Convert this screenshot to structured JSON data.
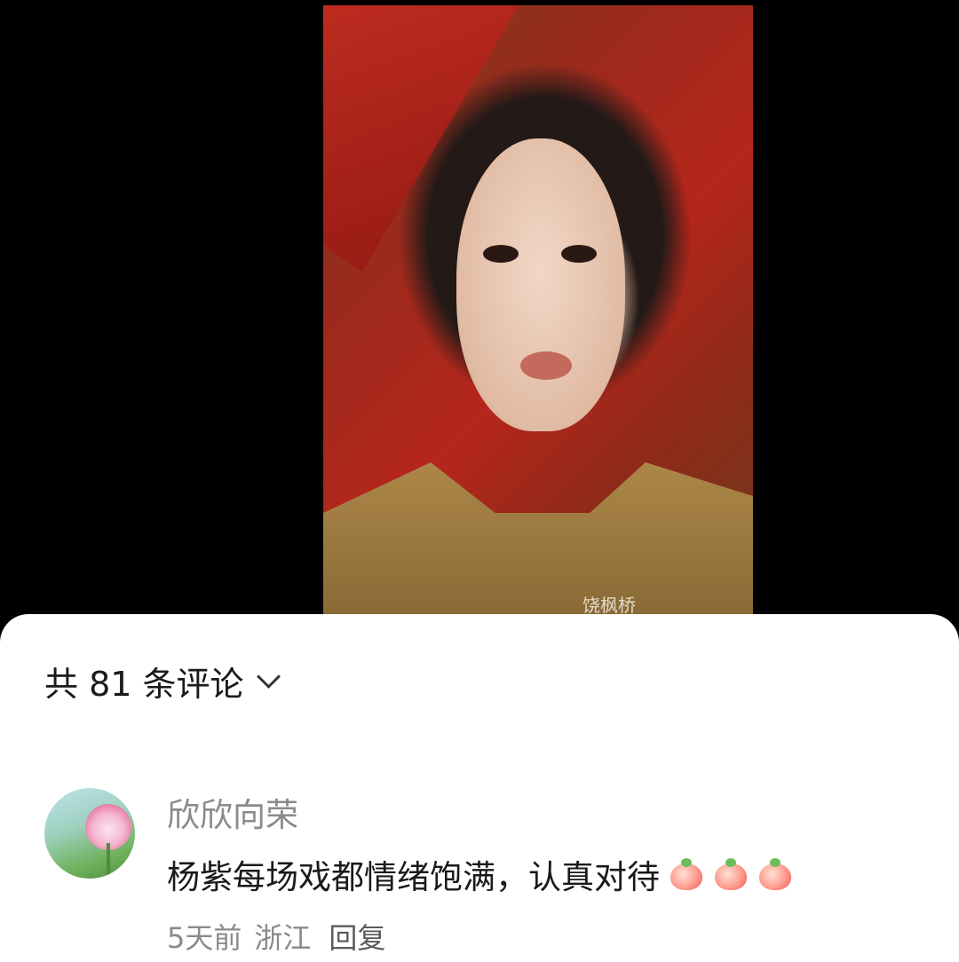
{
  "video": {
    "watermark": "饶枫桥"
  },
  "comments_panel": {
    "count_label": "共 81 条评论",
    "sort_icon": "chevron-down-icon",
    "items": [
      {
        "username": "欣欣向荣",
        "text": "杨紫每场戏都情绪饱满，认真对待",
        "emojis": [
          "peach",
          "peach",
          "peach"
        ],
        "time": "5天前",
        "location": "浙江",
        "reply_label": "回复"
      }
    ]
  },
  "colors": {
    "sheet_bg": "#ffffff",
    "primary_text": "#1a1a1a",
    "secondary_text": "#8a8a8a"
  }
}
